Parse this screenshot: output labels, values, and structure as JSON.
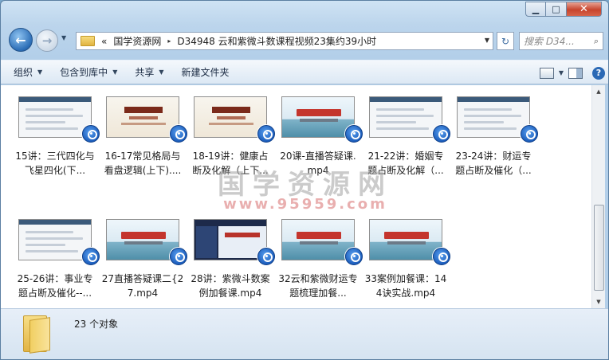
{
  "window": {
    "minimize_glyph": "▁",
    "maximize_glyph": "□",
    "close_glyph": "✕"
  },
  "nav": {
    "back_glyph": "←",
    "forward_glyph": "→",
    "recent_glyph": "▼"
  },
  "address": {
    "overflow": "«",
    "crumbs": [
      "国学资源网",
      "D34948 云和紫微斗数课程视频23集约39小时"
    ],
    "separator": "▸",
    "dropdown_glyph": "▼"
  },
  "refresh": {
    "glyph": "↻"
  },
  "search": {
    "placeholder": "搜索 D34...",
    "icon": "search-icon",
    "glyph": "⌕"
  },
  "toolbar": {
    "organize": "组织",
    "include_in_library": "包含到库中",
    "share": "共享",
    "new_folder": "新建文件夹",
    "arrow": "▼",
    "help_glyph": "?"
  },
  "files": [
    {
      "name": "15讲：三代四化与飞星四化(下..."
    },
    {
      "name": "16-17常见格局与看盘逻辑(上下)...."
    },
    {
      "name": "18-19讲：健康占断及化解（上下..."
    },
    {
      "name": "20课-直播答疑课.mp4"
    },
    {
      "name": "21-22讲：婚姻专题占断及化解（..."
    },
    {
      "name": "23-24讲：财运专题占断及催化（..."
    },
    {
      "name": "25-26讲：事业专题占断及催化--..."
    },
    {
      "name": "27直播答疑课二{27.mp4"
    },
    {
      "name": "28讲：紫微斗数案例加餐课.mp4"
    },
    {
      "name": "32云和紫微财运专题梳理加餐..."
    },
    {
      "name": "33案例加餐课：144诀实战.mp4"
    }
  ],
  "watermark": {
    "text": "国学资源网",
    "url": "www.95959.com"
  },
  "status": {
    "count_text": "23 个对象"
  },
  "scrollbar": {
    "up_glyph": "▲",
    "down_glyph": "▼"
  }
}
